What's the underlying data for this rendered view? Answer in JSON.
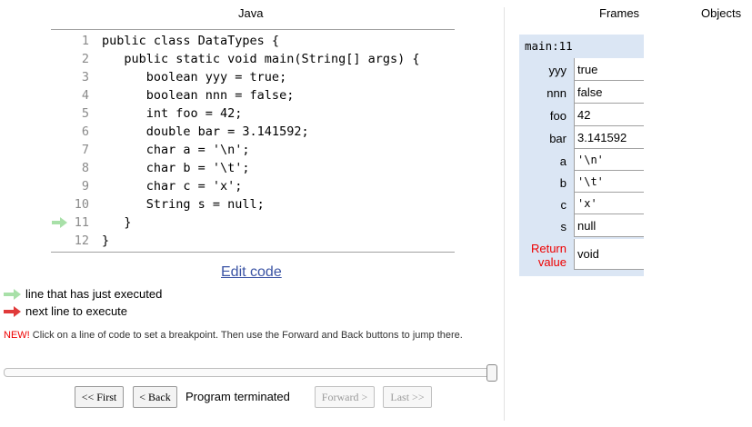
{
  "header": {
    "language": "Java",
    "frames_label": "Frames",
    "objects_label": "Objects"
  },
  "code": {
    "lines": [
      {
        "num": "1",
        "text": "public class DataTypes {"
      },
      {
        "num": "2",
        "text": "   public static void main(String[] args) {"
      },
      {
        "num": "3",
        "text": "      boolean yyy = true;"
      },
      {
        "num": "4",
        "text": "      boolean nnn = false;"
      },
      {
        "num": "5",
        "text": "      int foo = 42;"
      },
      {
        "num": "6",
        "text": "      double bar = 3.141592;"
      },
      {
        "num": "7",
        "text": "      char a = '\\n';"
      },
      {
        "num": "8",
        "text": "      char b = '\\t';"
      },
      {
        "num": "9",
        "text": "      char c = 'x';"
      },
      {
        "num": "10",
        "text": "      String s = null;"
      },
      {
        "num": "11",
        "text": "   }"
      },
      {
        "num": "12",
        "text": "}"
      }
    ],
    "just_executed_line": 11
  },
  "edit_link": "Edit code",
  "legend": {
    "just_executed": "line that has just executed",
    "next_line": "next line to execute"
  },
  "notice": {
    "new_label": "NEW!",
    "text": " Click on a line of code to set a breakpoint. Then use the Forward and Back buttons to jump there."
  },
  "slider": {
    "position": 1.0
  },
  "controls": {
    "first": "<< First",
    "back": "< Back",
    "status": "Program terminated",
    "forward": "Forward >",
    "last": "Last >>"
  },
  "frame": {
    "name": "main:11",
    "vars": [
      {
        "name": "yyy",
        "value": "true"
      },
      {
        "name": "nnn",
        "value": "false"
      },
      {
        "name": "foo",
        "value": "42"
      },
      {
        "name": "bar",
        "value": "3.141592"
      },
      {
        "name": "a",
        "value": "'\\n'"
      },
      {
        "name": "b",
        "value": "'\\t'"
      },
      {
        "name": "c",
        "value": "'x'"
      },
      {
        "name": "s",
        "value": "null"
      }
    ],
    "return_label_1": "Return",
    "return_label_2": "value",
    "return_value": "void"
  },
  "colors": {
    "green_arrow": "#a8e0a8",
    "red_arrow": "#e03a3a",
    "frame_bg": "#dbe6f4",
    "link": "#3a53a4"
  }
}
